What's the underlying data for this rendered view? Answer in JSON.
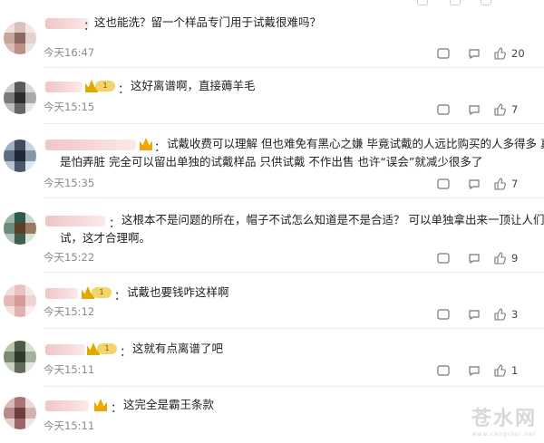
{
  "comments": [
    {
      "text1": "这也能洗？留一个样品专门用于试戴很难吗？",
      "text2": "",
      "time": "今天16:47",
      "likes": "20",
      "badge": "none"
    },
    {
      "text1": "这好离谱啊，直接薅羊毛",
      "text2": "",
      "time": "今天15:15",
      "likes": "7",
      "badge": "level"
    },
    {
      "text1": "试戴收费可以理解 但也难免有黑心之嫌 毕竟试戴的人远比购买的人多得多 真",
      "text2": "是怕弄脏 完全可以留出单独的试戴样品 只供试戴 不作出售 也许“误会”就减少很多了",
      "time": "今天15:35",
      "likes": "7",
      "badge": "small"
    },
    {
      "text1": "这根本不是问题的所在，帽子不试怎么知道是不是合适？ 可以单独拿出来一顶让人们去",
      "text2": "试，这才合理啊。",
      "time": "今天15:22",
      "likes": "9",
      "badge": "none"
    },
    {
      "text1": "试戴也要钱咋这样啊",
      "text2": "",
      "time": "今天15:12",
      "likes": "3",
      "badge": "level"
    },
    {
      "text1": "这就有点离谱了吧",
      "text2": "",
      "time": "今天15:11",
      "likes": "1",
      "badge": "level"
    },
    {
      "text1": "这完全是霸王条款",
      "text2": "",
      "time": "今天15:11",
      "likes": "",
      "badge": "small"
    }
  ],
  "badge_level": "1",
  "watermark": {
    "main": "苍水网",
    "url": "www.cangshui.net"
  }
}
